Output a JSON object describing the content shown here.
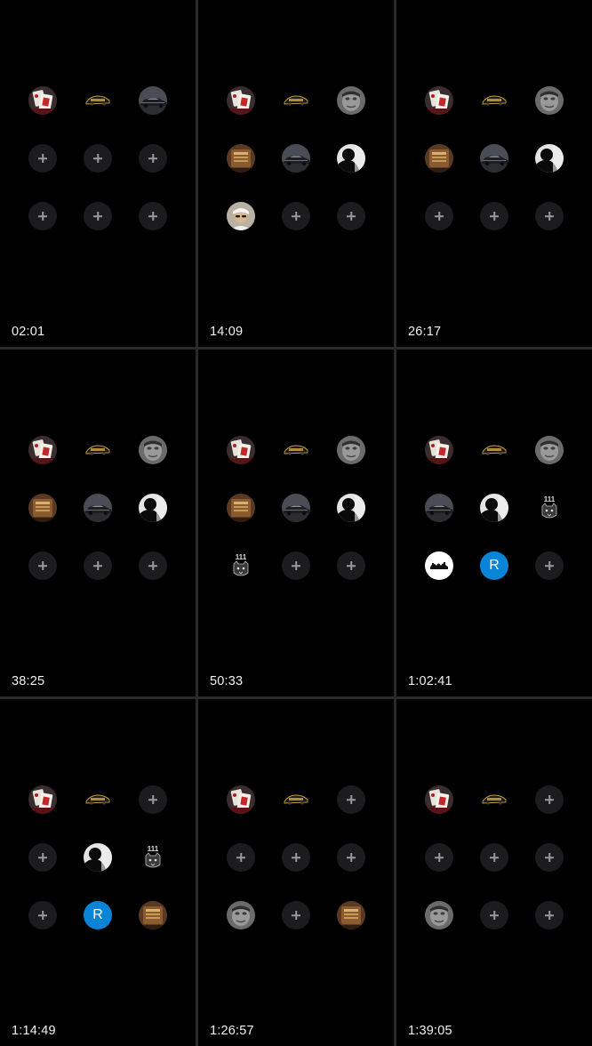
{
  "panels": [
    {
      "time": "02:01",
      "slots": [
        "cards",
        "car-logo",
        "car-photo",
        "empty",
        "empty",
        "empty",
        "empty",
        "empty",
        "empty"
      ]
    },
    {
      "time": "14:09",
      "slots": [
        "cards",
        "car-logo",
        "grey-face",
        "brown-badge",
        "car-photo",
        "silhouette",
        "person-photo",
        "empty",
        "empty"
      ]
    },
    {
      "time": "26:17",
      "slots": [
        "cards",
        "car-logo",
        "grey-face",
        "brown-badge",
        "car-photo",
        "silhouette",
        "empty",
        "empty",
        "empty"
      ]
    },
    {
      "time": "38:25",
      "slots": [
        "cards",
        "car-logo",
        "grey-face",
        "brown-badge",
        "car-photo",
        "silhouette",
        "empty",
        "empty",
        "empty"
      ]
    },
    {
      "time": "50:33",
      "slots": [
        "cards",
        "car-logo",
        "grey-face",
        "brown-badge",
        "car-photo",
        "silhouette",
        "tiger-111",
        "empty",
        "empty"
      ]
    },
    {
      "time": "1:02:41",
      "slots": [
        "cards",
        "car-logo",
        "grey-face",
        "car-photo",
        "silhouette",
        "tiger-111",
        "white-logo",
        "letter-r",
        "empty"
      ]
    },
    {
      "time": "1:14:49",
      "slots": [
        "cards",
        "car-logo",
        "empty",
        "empty",
        "silhouette",
        "tiger-111",
        "empty",
        "letter-r",
        "brown-badge"
      ]
    },
    {
      "time": "1:26:57",
      "slots": [
        "cards",
        "car-logo",
        "empty",
        "empty",
        "empty",
        "empty",
        "grey-face",
        "empty",
        "brown-badge"
      ]
    },
    {
      "time": "1:39:05",
      "slots": [
        "cards",
        "car-logo",
        "empty",
        "empty",
        "empty",
        "empty",
        "grey-face",
        "empty",
        "empty"
      ]
    }
  ],
  "letter_avatar": "R",
  "tiger_label": "111",
  "colors": {
    "background": "#000000",
    "divider": "#2a2a2a",
    "plus_bg": "#1c1c1e",
    "plus_icon": "#9a9a9a",
    "letter_bg": "#0a84d6",
    "time_text": "#f2f2f2"
  }
}
